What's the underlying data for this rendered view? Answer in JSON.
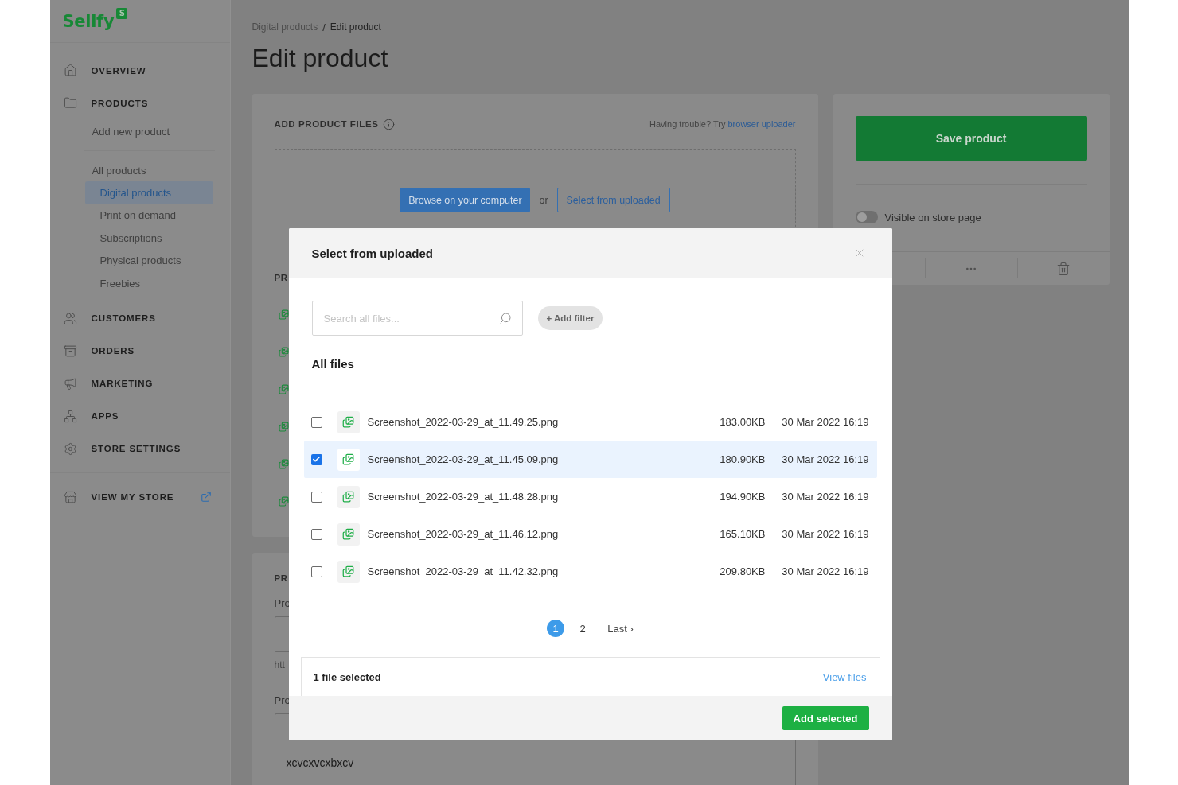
{
  "logo": {
    "wordmark": "Sellfy",
    "badge": "S"
  },
  "sidebar": {
    "items": [
      {
        "label": "OVERVIEW",
        "selected": false
      },
      {
        "label": "PRODUCTS",
        "selected": false,
        "children": [
          {
            "label": "Add new product",
            "selected": false
          },
          {
            "label": "All products",
            "selected": false,
            "children": [
              {
                "label": "Digital products",
                "selected": true
              },
              {
                "label": "Print on demand",
                "selected": false
              },
              {
                "label": "Subscriptions",
                "selected": false
              },
              {
                "label": "Physical products",
                "selected": false
              },
              {
                "label": "Freebies",
                "selected": false
              }
            ]
          }
        ]
      },
      {
        "label": "CUSTOMERS",
        "selected": false
      },
      {
        "label": "ORDERS",
        "selected": false
      },
      {
        "label": "MARKETING",
        "selected": false
      },
      {
        "label": "APPS",
        "selected": false
      },
      {
        "label": "STORE SETTINGS",
        "selected": false
      }
    ],
    "store_link": {
      "label": "VIEW MY STORE"
    }
  },
  "breadcrumb": {
    "items": [
      "Digital products",
      "Edit product"
    ],
    "separator": "/"
  },
  "title": "Edit product",
  "files_card": {
    "heading": "ADD PRODUCT FILES",
    "help_text": "Having trouble? Try",
    "help_link": "browser uploader",
    "browse_button": "Browse on your computer",
    "or_text": "or",
    "select_button": "Select from uploaded",
    "list_heading": "PR"
  },
  "details_card": {
    "heading": "PR",
    "fields": [
      {
        "kind": "input",
        "label": "Pro",
        "note": "htt"
      },
      {
        "kind": "editor",
        "label": "Pro",
        "value": "xcvcxvcxbxcv"
      }
    ]
  },
  "publish_card": {
    "save_button": "Save product",
    "visibility": {
      "label": "Visible on store page",
      "on": false
    }
  },
  "modal": {
    "title": "Select from uploaded",
    "search": {
      "placeholder": "Search all files..."
    },
    "add_filter": "+ Add filter",
    "section": "All files",
    "files": [
      {
        "name": "Screenshot_2022-03-29_at_11.49.25.png",
        "size": "183.00KB",
        "date": "30 Mar 2022 16:19",
        "selected": false
      },
      {
        "name": "Screenshot_2022-03-29_at_11.45.09.png",
        "size": "180.90KB",
        "date": "30 Mar 2022 16:19",
        "selected": true
      },
      {
        "name": "Screenshot_2022-03-29_at_11.48.28.png",
        "size": "194.90KB",
        "date": "30 Mar 2022 16:19",
        "selected": false
      },
      {
        "name": "Screenshot_2022-03-29_at_11.46.12.png",
        "size": "165.10KB",
        "date": "30 Mar 2022 16:19",
        "selected": false
      },
      {
        "name": "Screenshot_2022-03-29_at_11.42.32.png",
        "size": "209.80KB",
        "date": "30 Mar 2022 16:19",
        "selected": false
      }
    ],
    "pagination": {
      "pages": [
        {
          "label": "1",
          "selected": true
        },
        {
          "label": "2",
          "selected": false
        }
      ],
      "last": "Last ›"
    },
    "selection": {
      "count": "1 file selected",
      "view_link": "View files"
    },
    "add_button": "Add selected"
  }
}
